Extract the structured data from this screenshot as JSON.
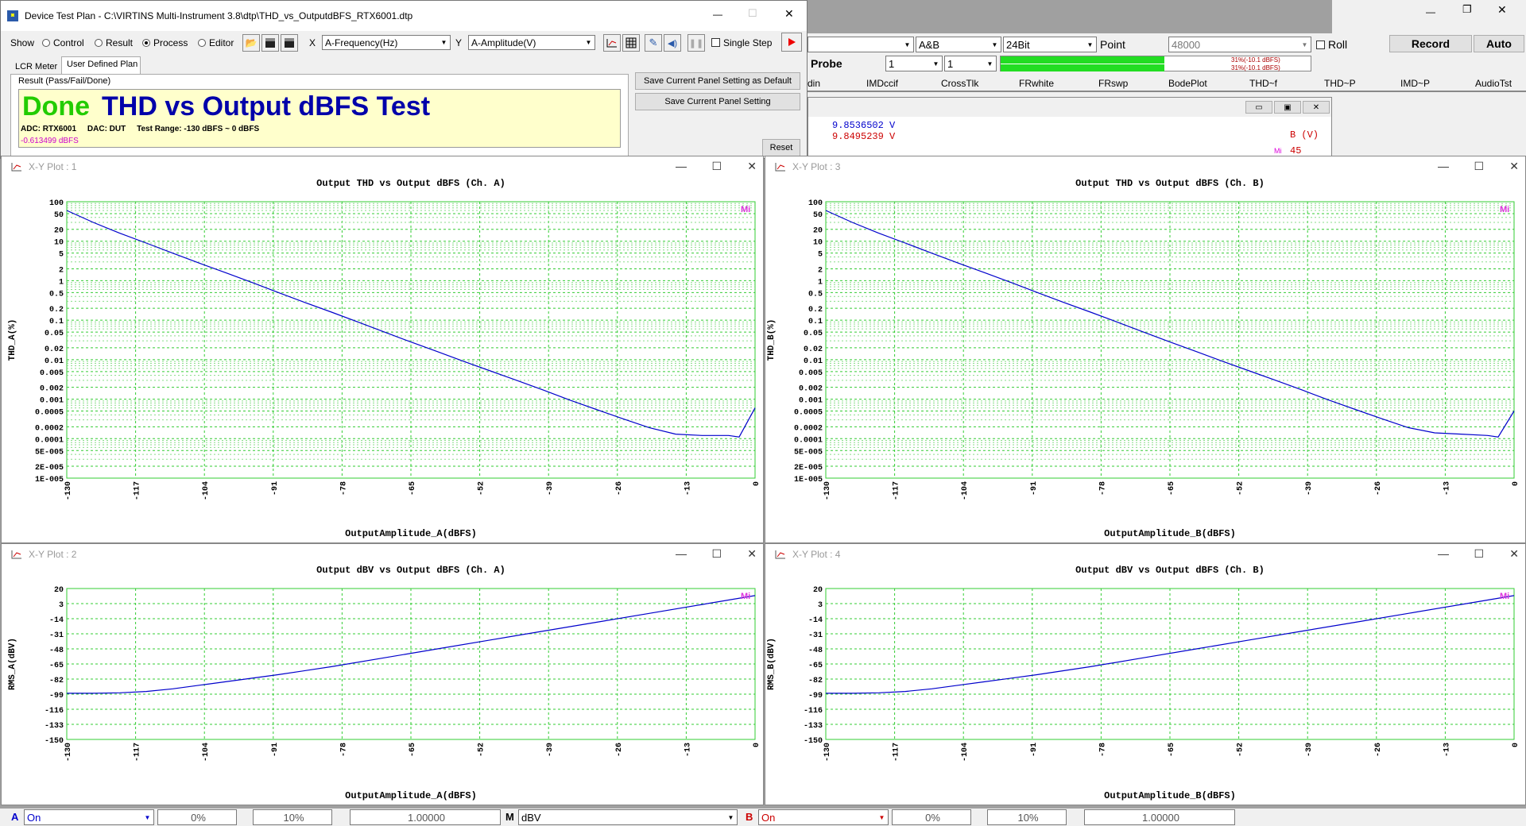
{
  "main_window": {
    "row1": {
      "channels": "A&B",
      "bits": "24Bit",
      "point_label": "Point",
      "point_value": "48000",
      "roll": "Roll",
      "record": "Record",
      "auto": "Auto"
    },
    "row2": {
      "probe": "Probe",
      "v1": "1",
      "v2": "1",
      "meter1": "31%(-10.1 dBFS)",
      "meter2": "31%(-10.1 dBFS)"
    },
    "tabs": [
      "din",
      "IMDccif",
      "CrossTlk",
      "FRwhite",
      "FRswp",
      "BodePlot",
      "THD~f",
      "THD~P",
      "IMD~P",
      "AudioTst"
    ],
    "readout": {
      "v1": "9.8536502  V",
      "v2": "9.8495239  V",
      "axis": "B (V)",
      "num": "45",
      "mark": "Mi"
    }
  },
  "dtp": {
    "title": "Device Test Plan - C:\\VIRTINS Multi-Instrument 3.8\\dtp\\THD_vs_OutputdBFS_RTX6001.dtp",
    "show_label": "Show",
    "radios": [
      {
        "label": "Control",
        "on": false
      },
      {
        "label": "Result",
        "on": false
      },
      {
        "label": "Process",
        "on": true
      },
      {
        "label": "Editor",
        "on": false
      }
    ],
    "x_label": "X",
    "x_value": "A-Frequency(Hz)",
    "y_label": "Y",
    "y_value": "A-Amplitude(V)",
    "single_step": "Single Step",
    "tabs": [
      "LCR Meter",
      "User Defined Plan"
    ],
    "result_label": "Result (Pass/Fail/Done)",
    "done": "Done",
    "test_title": "THD vs Output dBFS Test",
    "info": "ADC: RTX6001     DAC: DUT     Test Range: -130 dBFS ~ 0 dBFS",
    "value": "-0.613499 dBFS",
    "btn_default": "Save Current Panel Setting as Default",
    "btn_save": "Save Current Panel Setting",
    "btn_reset": "Reset"
  },
  "plots": [
    {
      "win": "X-Y Plot : 1",
      "title": "Output THD vs Output dBFS (Ch. A)",
      "ylabel": "THD_A(%)",
      "xlabel": "OutputAmplitude_A(dBFS)",
      "mark": "Mi"
    },
    {
      "win": "X-Y Plot : 3",
      "title": "Output THD vs Output dBFS (Ch. B)",
      "ylabel": "THD_B(%)",
      "xlabel": "OutputAmplitude_B(dBFS)",
      "mark": "Mi"
    },
    {
      "win": "X-Y Plot : 2",
      "title": "Output dBV vs Output dBFS (Ch. A)",
      "ylabel": "RMS_A(dBV)",
      "xlabel": "OutputAmplitude_A(dBFS)",
      "mark": "Mi"
    },
    {
      "win": "X-Y Plot : 4",
      "title": "Output dBV vs Output dBFS (Ch. B)",
      "ylabel": "RMS_B(dBV)",
      "xlabel": "OutputAmplitude_B(dBFS)",
      "mark": "Mi"
    }
  ],
  "bottom": {
    "a": "A",
    "a_mode": "On",
    "a_p1": "0%",
    "a_p2": "10%",
    "a_val": "1.00000",
    "m": "M",
    "m_unit": "dBV",
    "b": "B",
    "b_mode": "On",
    "b_p1": "0%",
    "b_p2": "10%",
    "b_val": "1.00000"
  },
  "chart_data": [
    {
      "type": "line",
      "title": "Output THD vs Output dBFS (Ch. A)",
      "xlabel": "OutputAmplitude_A(dBFS)",
      "ylabel": "THD_A(%)",
      "yscale": "log",
      "xlim": [
        -130,
        0
      ],
      "ylim": [
        1e-05,
        100
      ],
      "x_ticks": [
        "-130",
        "-117",
        "-104",
        "-91",
        "-78",
        "-65",
        "-52",
        "-39",
        "-26",
        "-13",
        "0"
      ],
      "y_ticks": [
        "100",
        "50",
        "20",
        "10",
        "5",
        "2",
        "1",
        "0.5",
        "0.2",
        "0.1",
        "0.05",
        "0.02",
        "0.01",
        "0.005",
        "0.002",
        "0.001",
        "0.0005",
        "0.0002",
        "0.0001",
        "5E-005",
        "2E-005",
        "1E-005"
      ],
      "x": [
        -130,
        -125,
        -120,
        -115,
        -110,
        -105,
        -100,
        -95,
        -90,
        -85,
        -80,
        -75,
        -70,
        -65,
        -60,
        -55,
        -50,
        -45,
        -40,
        -35,
        -30,
        -25,
        -20,
        -15,
        -10,
        -5,
        -3,
        0
      ],
      "y": [
        60,
        30,
        16,
        9,
        5,
        2.8,
        1.6,
        0.9,
        0.5,
        0.28,
        0.16,
        0.09,
        0.05,
        0.028,
        0.016,
        0.009,
        0.0052,
        0.003,
        0.0017,
        0.00095,
        0.00055,
        0.00032,
        0.00019,
        0.00013,
        0.00012,
        0.00012,
        0.00011,
        0.0006
      ],
      "color": "#0000cc",
      "grid": true
    },
    {
      "type": "line",
      "title": "Output THD vs Output dBFS (Ch. B)",
      "xlabel": "OutputAmplitude_B(dBFS)",
      "ylabel": "THD_B(%)",
      "yscale": "log",
      "xlim": [
        -130,
        0
      ],
      "ylim": [
        1e-05,
        100
      ],
      "x_ticks": [
        "-130",
        "-117",
        "-104",
        "-91",
        "-78",
        "-65",
        "-52",
        "-39",
        "-26",
        "-13",
        "0"
      ],
      "y_ticks": [
        "100",
        "50",
        "20",
        "10",
        "5",
        "2",
        "1",
        "0.5",
        "0.2",
        "0.1",
        "0.05",
        "0.02",
        "0.01",
        "0.005",
        "0.002",
        "0.001",
        "0.0005",
        "0.0002",
        "0.0001",
        "5E-005",
        "2E-005",
        "1E-005"
      ],
      "x": [
        -130,
        -125,
        -120,
        -115,
        -110,
        -105,
        -100,
        -95,
        -90,
        -85,
        -80,
        -75,
        -70,
        -65,
        -60,
        -55,
        -50,
        -45,
        -40,
        -35,
        -30,
        -25,
        -20,
        -15,
        -10,
        -5,
        -3,
        0
      ],
      "y": [
        60,
        30,
        16,
        9,
        5,
        2.8,
        1.6,
        0.9,
        0.5,
        0.28,
        0.16,
        0.09,
        0.05,
        0.028,
        0.016,
        0.009,
        0.0052,
        0.003,
        0.0017,
        0.00095,
        0.00055,
        0.00032,
        0.00019,
        0.00014,
        0.00013,
        0.00012,
        0.00011,
        0.0005
      ],
      "color": "#0000cc",
      "grid": true
    },
    {
      "type": "line",
      "title": "Output dBV vs Output dBFS (Ch. A)",
      "xlabel": "OutputAmplitude_A(dBFS)",
      "ylabel": "RMS_A(dBV)",
      "yscale": "linear",
      "xlim": [
        -130,
        0
      ],
      "ylim": [
        -150,
        20
      ],
      "x_ticks": [
        "-130",
        "-117",
        "-104",
        "-91",
        "-78",
        "-65",
        "-52",
        "-39",
        "-26",
        "-13",
        "0"
      ],
      "y_ticks": [
        "20",
        "3",
        "-14",
        "-31",
        "-48",
        "-65",
        "-82",
        "-99",
        "-116",
        "-133",
        "-150"
      ],
      "x": [
        -130,
        -125,
        -120,
        -115,
        -110,
        -105,
        -100,
        -90,
        -80,
        -70,
        -60,
        -50,
        -40,
        -30,
        -20,
        -10,
        0
      ],
      "y": [
        -98,
        -98,
        -97.5,
        -96,
        -93,
        -89,
        -85,
        -77,
        -68,
        -58,
        -48,
        -38,
        -28,
        -18,
        -8,
        2,
        12
      ],
      "color": "#0000cc",
      "grid": true
    },
    {
      "type": "line",
      "title": "Output dBV vs Output dBFS (Ch. B)",
      "xlabel": "OutputAmplitude_B(dBFS)",
      "ylabel": "RMS_B(dBV)",
      "yscale": "linear",
      "xlim": [
        -130,
        0
      ],
      "ylim": [
        -150,
        20
      ],
      "x_ticks": [
        "-130",
        "-117",
        "-104",
        "-91",
        "-78",
        "-65",
        "-52",
        "-39",
        "-26",
        "-13",
        "0"
      ],
      "y_ticks": [
        "20",
        "3",
        "-14",
        "-31",
        "-48",
        "-65",
        "-82",
        "-99",
        "-116",
        "-133",
        "-150"
      ],
      "x": [
        -130,
        -125,
        -120,
        -115,
        -110,
        -105,
        -100,
        -90,
        -80,
        -70,
        -60,
        -50,
        -40,
        -30,
        -20,
        -10,
        0
      ],
      "y": [
        -98,
        -98,
        -97.5,
        -96,
        -93,
        -89,
        -85,
        -77,
        -68,
        -58,
        -48,
        -38,
        -28,
        -18,
        -8,
        2,
        12
      ],
      "color": "#0000cc",
      "grid": true
    }
  ]
}
